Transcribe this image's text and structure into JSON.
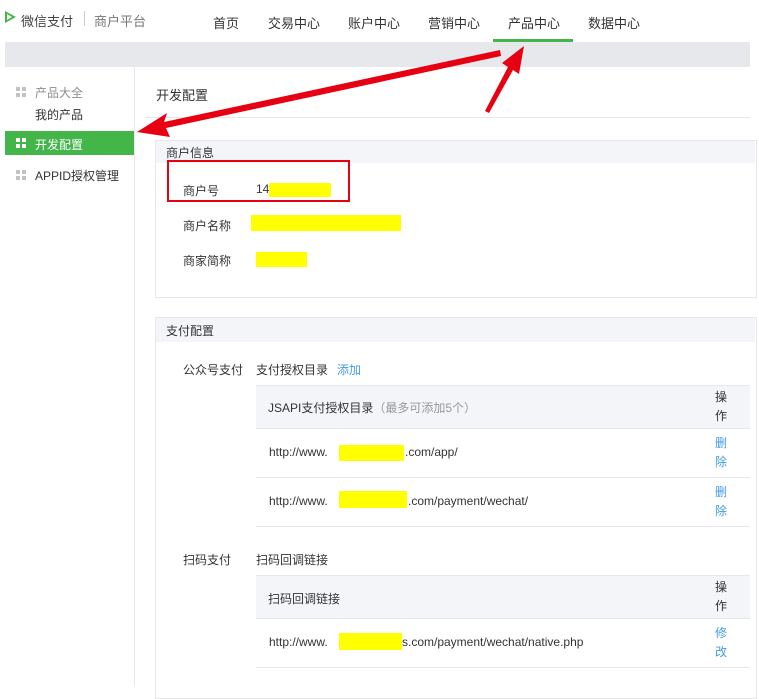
{
  "header": {
    "logo_text": "微信支付",
    "logo_sub": "商户平台",
    "nav": [
      "首页",
      "交易中心",
      "账户中心",
      "营销中心",
      "产品中心",
      "数据中心"
    ],
    "active_nav": "产品中心"
  },
  "sidebar": {
    "items": [
      {
        "label": "产品大全",
        "icon": "grid-icon"
      },
      {
        "label": "我的产品"
      },
      {
        "label": "开发配置",
        "icon": "grid-icon",
        "active": true
      },
      {
        "label": "APPID授权管理",
        "icon": "grid-icon"
      }
    ]
  },
  "page": {
    "title": "开发配置"
  },
  "merchant": {
    "section_title": "商户信息",
    "id_label": "商户号",
    "id_value": "14",
    "name_label": "商户名称",
    "short_label": "商家简称"
  },
  "payment": {
    "section_title": "支付配置",
    "jsapi": {
      "label": "公众号支付",
      "dir_label": "支付授权目录",
      "add_link": "添加",
      "table_header": "JSAPI支付授权目录",
      "table_header_hint": "（最多可添加5个）",
      "op_header": "操作",
      "rows": [
        {
          "prefix": "http://www.",
          "suffix": ".com/app/",
          "action": "删除"
        },
        {
          "prefix": "http://www.",
          "suffix": ".com/payment/wechat/",
          "action": "删除"
        }
      ]
    },
    "native": {
      "label": "扫码支付",
      "callback_label": "扫码回调链接",
      "table_header": "扫码回调链接",
      "op_header": "操作",
      "rows": [
        {
          "prefix": "http://www.",
          "suffix": "s.com/payment/wechat/native.php",
          "action": "修改"
        }
      ]
    }
  },
  "colors": {
    "accent": "#44b549",
    "highlight": "#ffff00",
    "annotation": "#e60012",
    "link": "#459ae9"
  }
}
